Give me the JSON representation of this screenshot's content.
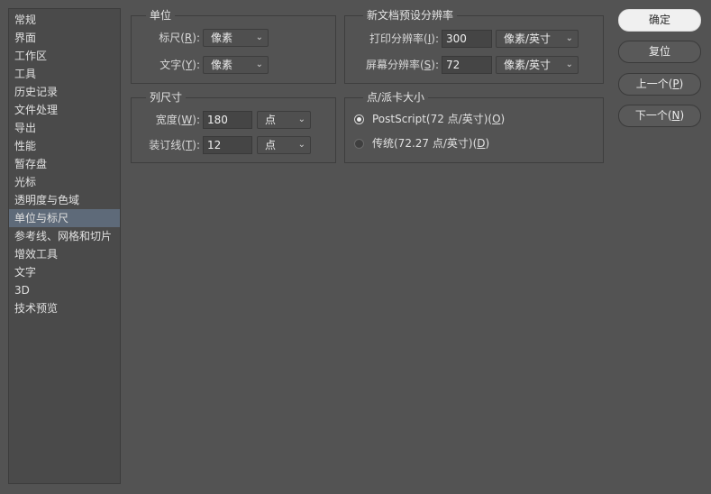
{
  "sidebar": {
    "items": [
      {
        "label": "常规"
      },
      {
        "label": "界面"
      },
      {
        "label": "工作区"
      },
      {
        "label": "工具"
      },
      {
        "label": "历史记录"
      },
      {
        "label": "文件处理"
      },
      {
        "label": "导出"
      },
      {
        "label": "性能"
      },
      {
        "label": "暂存盘"
      },
      {
        "label": "光标"
      },
      {
        "label": "透明度与色域"
      },
      {
        "label": "单位与标尺"
      },
      {
        "label": "参考线、网格和切片"
      },
      {
        "label": "增效工具"
      },
      {
        "label": "文字"
      },
      {
        "label": "3D"
      },
      {
        "label": "技术预览"
      }
    ],
    "selected": "单位与标尺"
  },
  "units": {
    "title": "单位",
    "ruler_label": "标尺(",
    "ruler_key": "R",
    "ruler_tail": "):",
    "ruler_value": "像素",
    "type_label": "文字(",
    "type_key": "Y",
    "type_tail": "):",
    "type_value": "像素"
  },
  "column": {
    "title": "列尺寸",
    "width_label": "宽度(",
    "width_key": "W",
    "width_tail": "):",
    "width_value": "180",
    "width_unit": "点",
    "gutter_label": "装订线(",
    "gutter_key": "T",
    "gutter_tail": "):",
    "gutter_value": "12",
    "gutter_unit": "点"
  },
  "resolution": {
    "title": "新文档预设分辨率",
    "print_label": "打印分辨率(",
    "print_key": "I",
    "print_tail": "):",
    "print_value": "300",
    "print_unit": "像素/英寸",
    "screen_label": "屏幕分辨率(",
    "screen_key": "S",
    "screen_tail": "):",
    "screen_value": "72",
    "screen_unit": "像素/英寸"
  },
  "points": {
    "title": "点/派卡大小",
    "postscript_label": "PostScript(72 点/英寸)(",
    "postscript_key": "O",
    "postscript_tail": ")",
    "traditional_label": "传统(72.27 点/英寸)(",
    "traditional_key": "D",
    "traditional_tail": ")",
    "selected": "postscript"
  },
  "buttons": {
    "ok": "确定",
    "reset": "复位",
    "prev_label": "上一个(",
    "prev_key": "P",
    "prev_tail": ")",
    "next_label": "下一个(",
    "next_key": "N",
    "next_tail": ")"
  }
}
